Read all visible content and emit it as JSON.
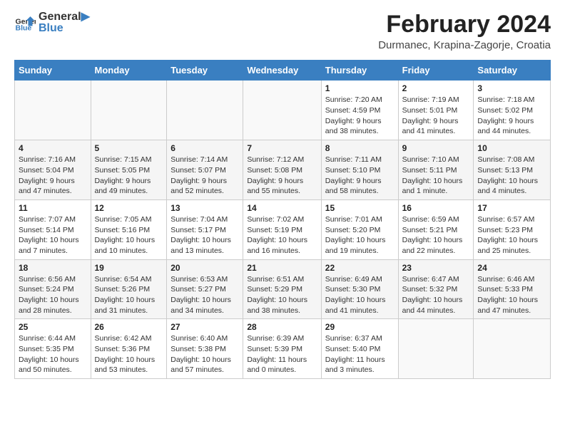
{
  "header": {
    "logo_general": "General",
    "logo_blue": "Blue",
    "title": "February 2024",
    "location": "Durmanec, Krapina-Zagorje, Croatia"
  },
  "days_of_week": [
    "Sunday",
    "Monday",
    "Tuesday",
    "Wednesday",
    "Thursday",
    "Friday",
    "Saturday"
  ],
  "weeks": [
    [
      {
        "day": "",
        "info": ""
      },
      {
        "day": "",
        "info": ""
      },
      {
        "day": "",
        "info": ""
      },
      {
        "day": "",
        "info": ""
      },
      {
        "day": "1",
        "info": "Sunrise: 7:20 AM\nSunset: 4:59 PM\nDaylight: 9 hours\nand 38 minutes."
      },
      {
        "day": "2",
        "info": "Sunrise: 7:19 AM\nSunset: 5:01 PM\nDaylight: 9 hours\nand 41 minutes."
      },
      {
        "day": "3",
        "info": "Sunrise: 7:18 AM\nSunset: 5:02 PM\nDaylight: 9 hours\nand 44 minutes."
      }
    ],
    [
      {
        "day": "4",
        "info": "Sunrise: 7:16 AM\nSunset: 5:04 PM\nDaylight: 9 hours\nand 47 minutes."
      },
      {
        "day": "5",
        "info": "Sunrise: 7:15 AM\nSunset: 5:05 PM\nDaylight: 9 hours\nand 49 minutes."
      },
      {
        "day": "6",
        "info": "Sunrise: 7:14 AM\nSunset: 5:07 PM\nDaylight: 9 hours\nand 52 minutes."
      },
      {
        "day": "7",
        "info": "Sunrise: 7:12 AM\nSunset: 5:08 PM\nDaylight: 9 hours\nand 55 minutes."
      },
      {
        "day": "8",
        "info": "Sunrise: 7:11 AM\nSunset: 5:10 PM\nDaylight: 9 hours\nand 58 minutes."
      },
      {
        "day": "9",
        "info": "Sunrise: 7:10 AM\nSunset: 5:11 PM\nDaylight: 10 hours\nand 1 minute."
      },
      {
        "day": "10",
        "info": "Sunrise: 7:08 AM\nSunset: 5:13 PM\nDaylight: 10 hours\nand 4 minutes."
      }
    ],
    [
      {
        "day": "11",
        "info": "Sunrise: 7:07 AM\nSunset: 5:14 PM\nDaylight: 10 hours\nand 7 minutes."
      },
      {
        "day": "12",
        "info": "Sunrise: 7:05 AM\nSunset: 5:16 PM\nDaylight: 10 hours\nand 10 minutes."
      },
      {
        "day": "13",
        "info": "Sunrise: 7:04 AM\nSunset: 5:17 PM\nDaylight: 10 hours\nand 13 minutes."
      },
      {
        "day": "14",
        "info": "Sunrise: 7:02 AM\nSunset: 5:19 PM\nDaylight: 10 hours\nand 16 minutes."
      },
      {
        "day": "15",
        "info": "Sunrise: 7:01 AM\nSunset: 5:20 PM\nDaylight: 10 hours\nand 19 minutes."
      },
      {
        "day": "16",
        "info": "Sunrise: 6:59 AM\nSunset: 5:21 PM\nDaylight: 10 hours\nand 22 minutes."
      },
      {
        "day": "17",
        "info": "Sunrise: 6:57 AM\nSunset: 5:23 PM\nDaylight: 10 hours\nand 25 minutes."
      }
    ],
    [
      {
        "day": "18",
        "info": "Sunrise: 6:56 AM\nSunset: 5:24 PM\nDaylight: 10 hours\nand 28 minutes."
      },
      {
        "day": "19",
        "info": "Sunrise: 6:54 AM\nSunset: 5:26 PM\nDaylight: 10 hours\nand 31 minutes."
      },
      {
        "day": "20",
        "info": "Sunrise: 6:53 AM\nSunset: 5:27 PM\nDaylight: 10 hours\nand 34 minutes."
      },
      {
        "day": "21",
        "info": "Sunrise: 6:51 AM\nSunset: 5:29 PM\nDaylight: 10 hours\nand 38 minutes."
      },
      {
        "day": "22",
        "info": "Sunrise: 6:49 AM\nSunset: 5:30 PM\nDaylight: 10 hours\nand 41 minutes."
      },
      {
        "day": "23",
        "info": "Sunrise: 6:47 AM\nSunset: 5:32 PM\nDaylight: 10 hours\nand 44 minutes."
      },
      {
        "day": "24",
        "info": "Sunrise: 6:46 AM\nSunset: 5:33 PM\nDaylight: 10 hours\nand 47 minutes."
      }
    ],
    [
      {
        "day": "25",
        "info": "Sunrise: 6:44 AM\nSunset: 5:35 PM\nDaylight: 10 hours\nand 50 minutes."
      },
      {
        "day": "26",
        "info": "Sunrise: 6:42 AM\nSunset: 5:36 PM\nDaylight: 10 hours\nand 53 minutes."
      },
      {
        "day": "27",
        "info": "Sunrise: 6:40 AM\nSunset: 5:38 PM\nDaylight: 10 hours\nand 57 minutes."
      },
      {
        "day": "28",
        "info": "Sunrise: 6:39 AM\nSunset: 5:39 PM\nDaylight: 11 hours\nand 0 minutes."
      },
      {
        "day": "29",
        "info": "Sunrise: 6:37 AM\nSunset: 5:40 PM\nDaylight: 11 hours\nand 3 minutes."
      },
      {
        "day": "",
        "info": ""
      },
      {
        "day": "",
        "info": ""
      }
    ]
  ]
}
